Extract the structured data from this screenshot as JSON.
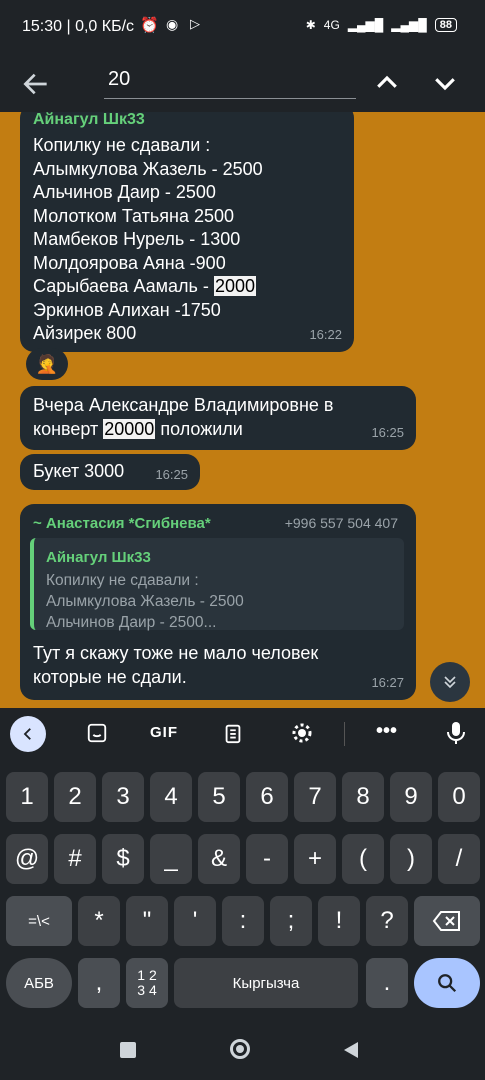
{
  "status_bar": {
    "time": "15:30 | 0,0 КБ/с",
    "battery": "88",
    "network": "4G"
  },
  "search": {
    "value": "20"
  },
  "messages": [
    {
      "sender": "Айнагул Шк33",
      "lines": [
        "Копилку не сдавали :",
        "Алымкулова Жазель - 2500",
        "Альчинов Даир - 2500",
        "Молотком Татьяна 2500",
        "Мамбеков Нурель - 1300",
        "Молдоярова Аяна  -900",
        "Сарыбаева Аамаль - ",
        "Эркинов Алихан -1750",
        "Айзирек 800"
      ],
      "highlight": "2000",
      "time": "16:22"
    },
    {
      "line1": "Вчера Александре Владимировне в",
      "line2_pre": "конверт ",
      "highlight": "20000",
      "line2_post": " положили",
      "time": "16:25"
    },
    {
      "text": "Букет 3000",
      "time": "16:25"
    },
    {
      "sender": "~ Анастасия *Сгибнева*",
      "phone": "+996 557 504 407",
      "quote_sender": "Айнагул Шк33",
      "quote_lines": [
        "Копилку не сдавали :",
        "Алымкулова Жазель - 2500",
        "Альчинов Даир - 2500..."
      ],
      "lines": [
        "Тут я скажу тоже не мало человек",
        "которые не сдали."
      ],
      "time": "16:27"
    }
  ],
  "keyboard": {
    "gif_label": "GIF",
    "row1": [
      "1",
      "2",
      "3",
      "4",
      "5",
      "6",
      "7",
      "8",
      "9",
      "0"
    ],
    "row2": [
      "@",
      "#",
      "$",
      "_",
      "&",
      "-",
      "+",
      "(",
      ")",
      "/"
    ],
    "row3_first": "=\\<",
    "row3": [
      "*",
      "\"",
      "'",
      ":",
      ";",
      "!",
      "?"
    ],
    "layout_key": "АБВ",
    "comma": ",",
    "numpad_top": "1 2",
    "numpad_bottom": "3 4",
    "space_label": "Кыргызча",
    "period": "."
  },
  "colors": {
    "accent_green": "#65d07a",
    "bubble_bg": "#212a31",
    "wallpaper": "#c27d12",
    "search_key": "#a9c5ff"
  }
}
